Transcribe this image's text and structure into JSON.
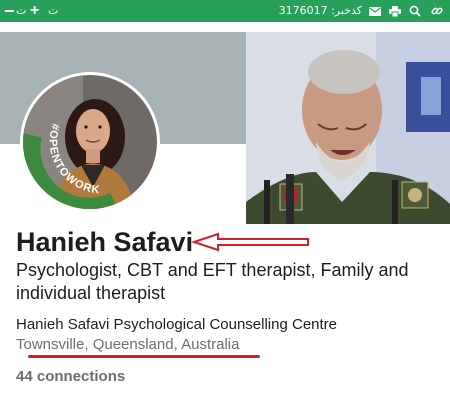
{
  "toolbar": {
    "minus": "−",
    "char_left": "ت",
    "plus": "+",
    "char_right": "ت",
    "code": "کدخبر: 3176017",
    "icons": [
      "mail-icon",
      "print-icon",
      "search-icon",
      "link-icon"
    ]
  },
  "profile": {
    "open_to_work_badge": "#OPENTOWORK",
    "name": "Hanieh Safavi",
    "headline": "Psychologist, CBT and EFT therapist, Family and individual therapist",
    "organization": "Hanieh Safavi Psychological Counselling Centre",
    "location": "Townsville, Queensland, Australia",
    "connections": "44 connections"
  },
  "colors": {
    "toolbar": "#27a05a",
    "banner": "#a7b2b4",
    "open_to_work_green": "#3b8a3e",
    "annotation_red": "#d11f25",
    "uniform_green": "#3c4a2d"
  }
}
